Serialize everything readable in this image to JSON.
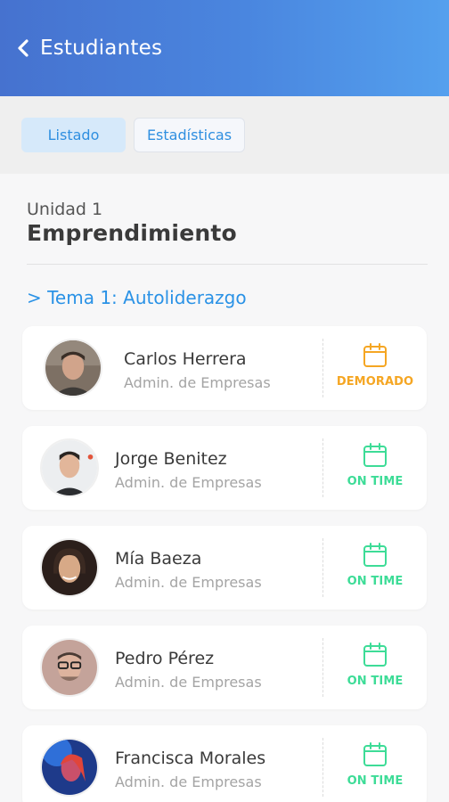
{
  "header": {
    "title": "Estudiantes",
    "back_icon": "chevron-left-icon"
  },
  "tabs": [
    {
      "label": "Listado",
      "active": true
    },
    {
      "label": "Estadísticas",
      "active": false
    }
  ],
  "unit": {
    "label": "Unidad 1",
    "title": "Emprendimiento"
  },
  "topic": {
    "label": "> Tema 1: Autoliderazgo"
  },
  "colors": {
    "late": "#f5a623",
    "on_time": "#3ddc97",
    "accent": "#2f8fe0"
  },
  "students": [
    {
      "name": "Carlos Herrera",
      "career": "Admin. de Empresas",
      "status": "DEMORADO",
      "status_type": "late",
      "icon": "calendar-icon"
    },
    {
      "name": "Jorge Benitez",
      "career": "Admin. de Empresas",
      "status": "ON TIME",
      "status_type": "on_time",
      "icon": "calendar-icon"
    },
    {
      "name": "Mía Baeza",
      "career": "Admin. de Empresas",
      "status": "ON TIME",
      "status_type": "on_time",
      "icon": "calendar-icon"
    },
    {
      "name": "Pedro Pérez",
      "career": "Admin. de Empresas",
      "status": "ON TIME",
      "status_type": "on_time",
      "icon": "calendar-icon"
    },
    {
      "name": "Francisca Morales",
      "career": "Admin. de Empresas",
      "status": "ON TIME",
      "status_type": "on_time",
      "icon": "calendar-icon"
    }
  ]
}
